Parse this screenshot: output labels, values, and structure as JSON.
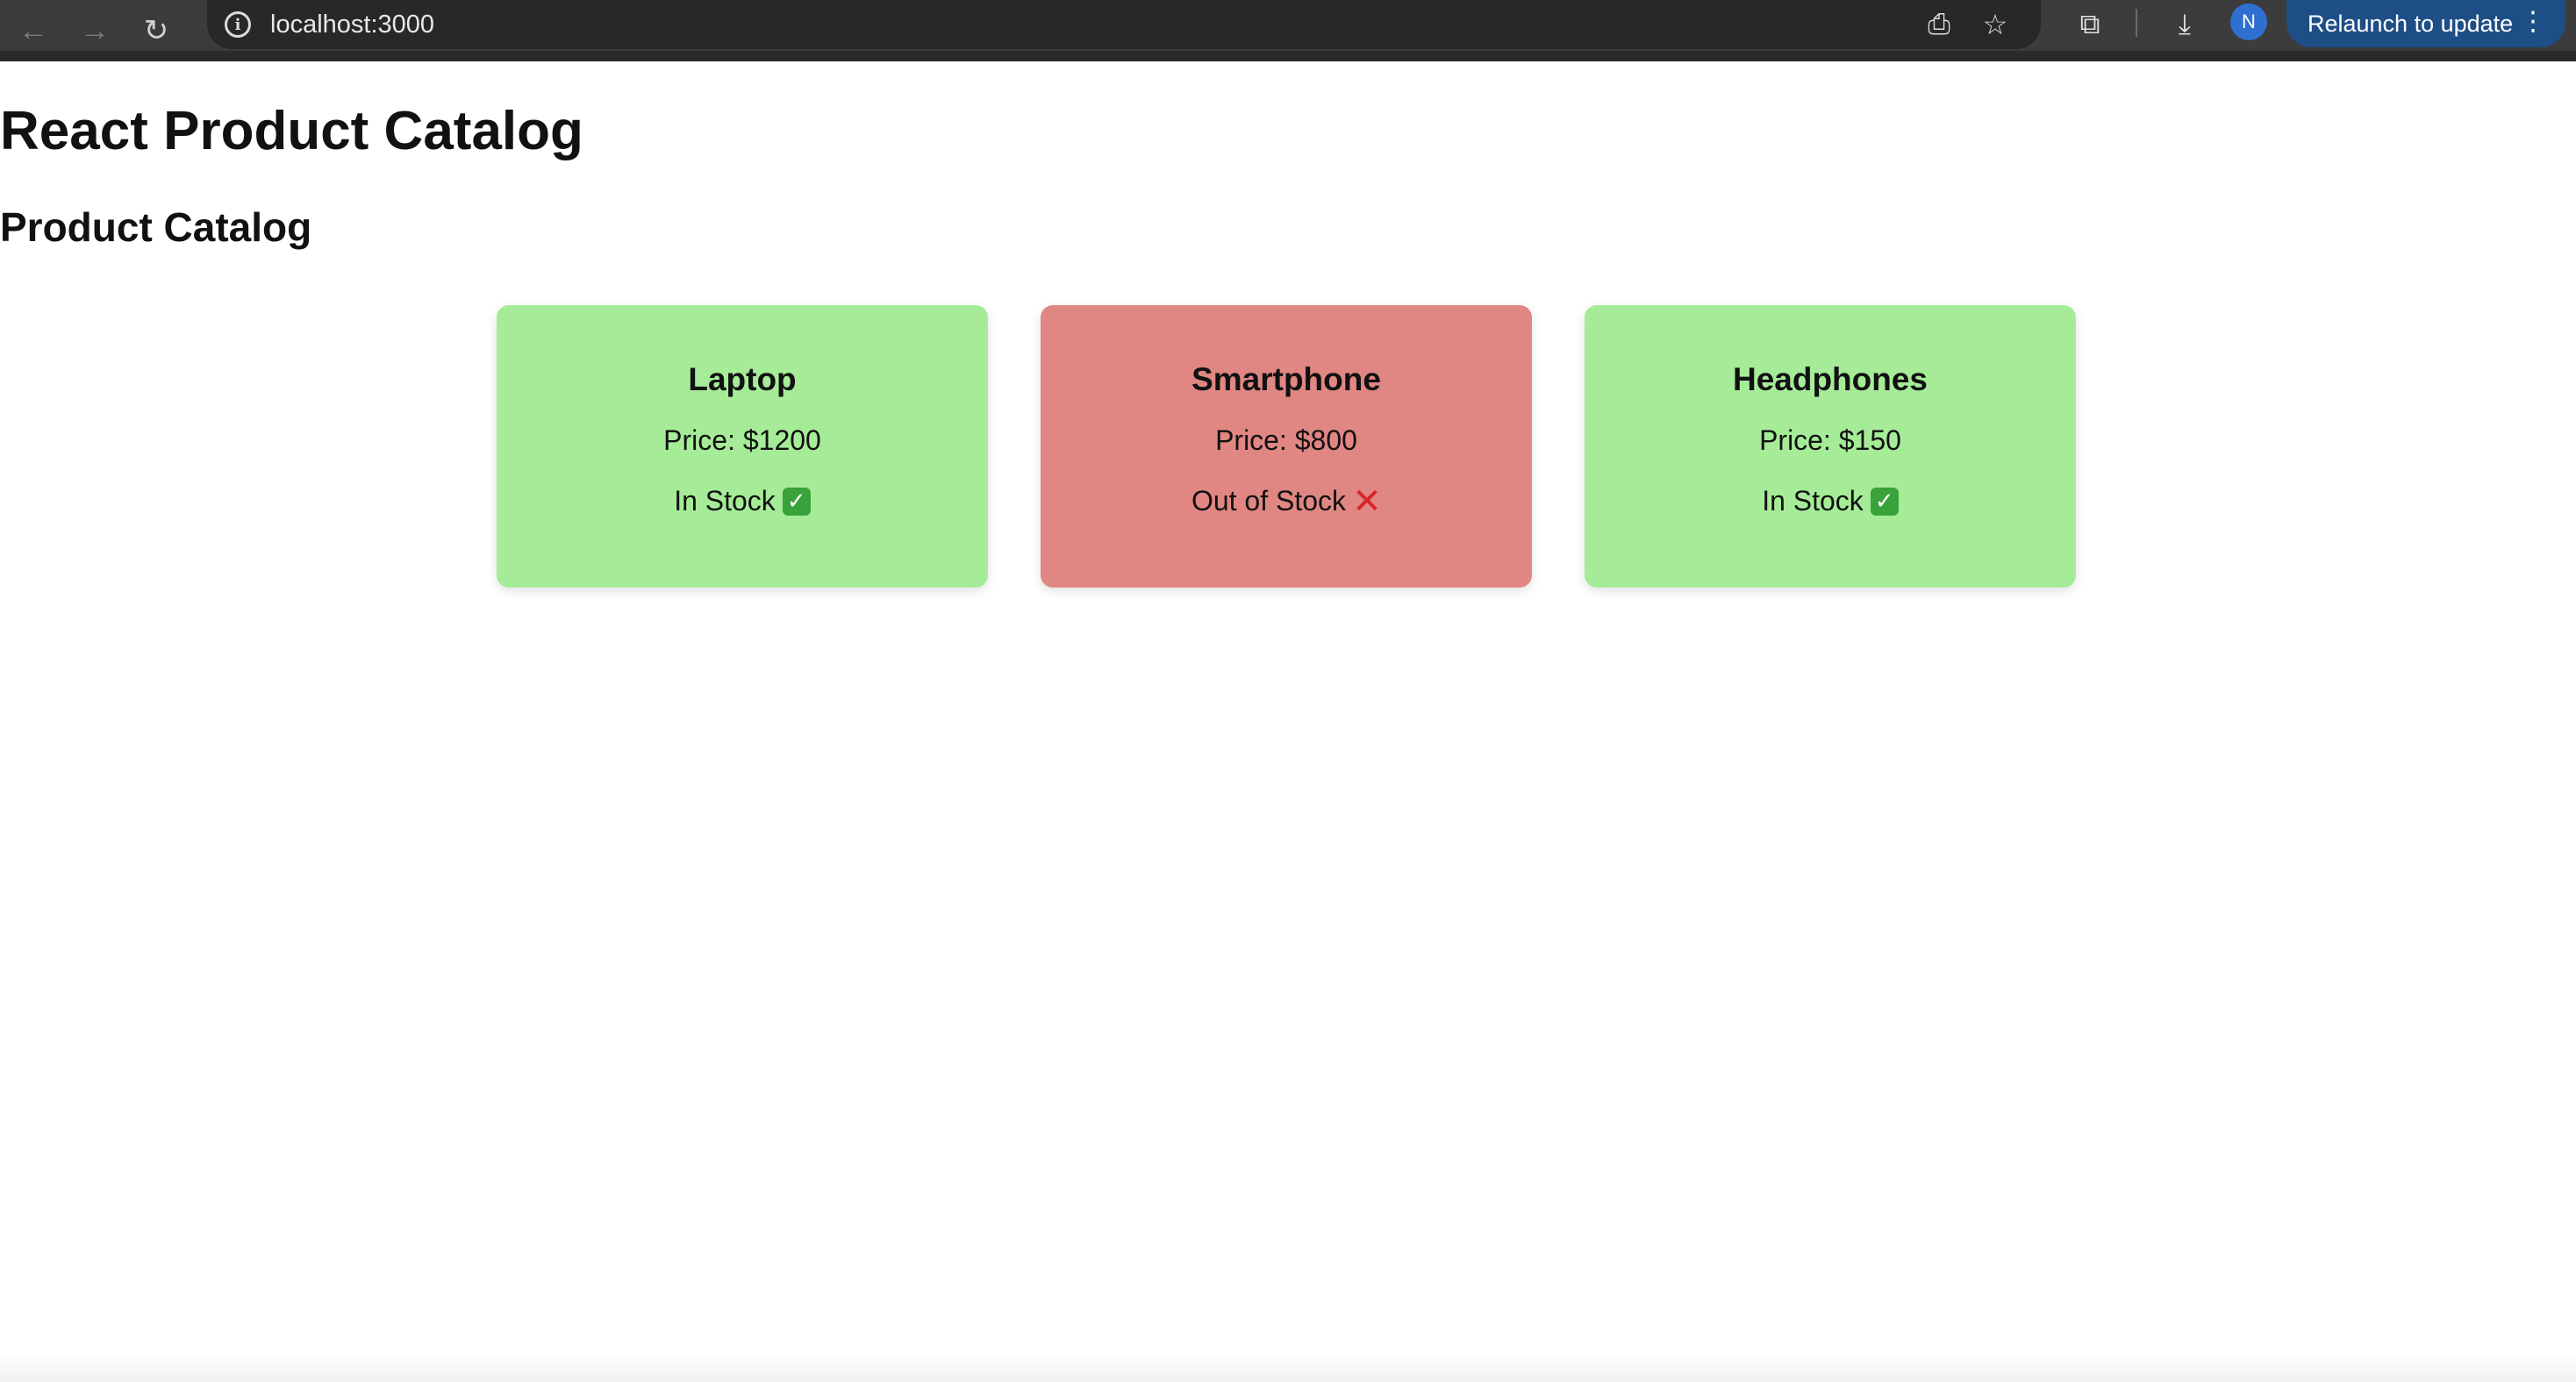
{
  "browser": {
    "url": "localhost:3000",
    "back_icon": "←",
    "forward_icon": "→",
    "reload_icon": "↻",
    "info_icon": "i",
    "install_icon": "⎙",
    "bookmark_icon": "☆",
    "extensions_icon": "⧉",
    "download_icon": "⤓",
    "avatar_initial": "N",
    "relaunch_label": "Relaunch to update",
    "menu_icon": "⋮"
  },
  "page": {
    "title": "React Product Catalog",
    "subtitle": "Product Catalog"
  },
  "products": [
    {
      "name": "Laptop",
      "price": "Price: $1200",
      "stock": "In Stock",
      "stock_icon": "✓",
      "in_stock": true
    },
    {
      "name": "Smartphone",
      "price": "Price: $800",
      "stock": "Out of Stock",
      "stock_icon": "✕",
      "in_stock": false
    },
    {
      "name": "Headphones",
      "price": "Price: $150",
      "stock": "In Stock",
      "stock_icon": "✓",
      "in_stock": true
    }
  ],
  "colors": {
    "in_stock_bg": "#a6ec98",
    "out_stock_bg": "#e08683",
    "relaunch_bg": "#1e4e86",
    "avatar_bg": "#2f6fcf"
  }
}
